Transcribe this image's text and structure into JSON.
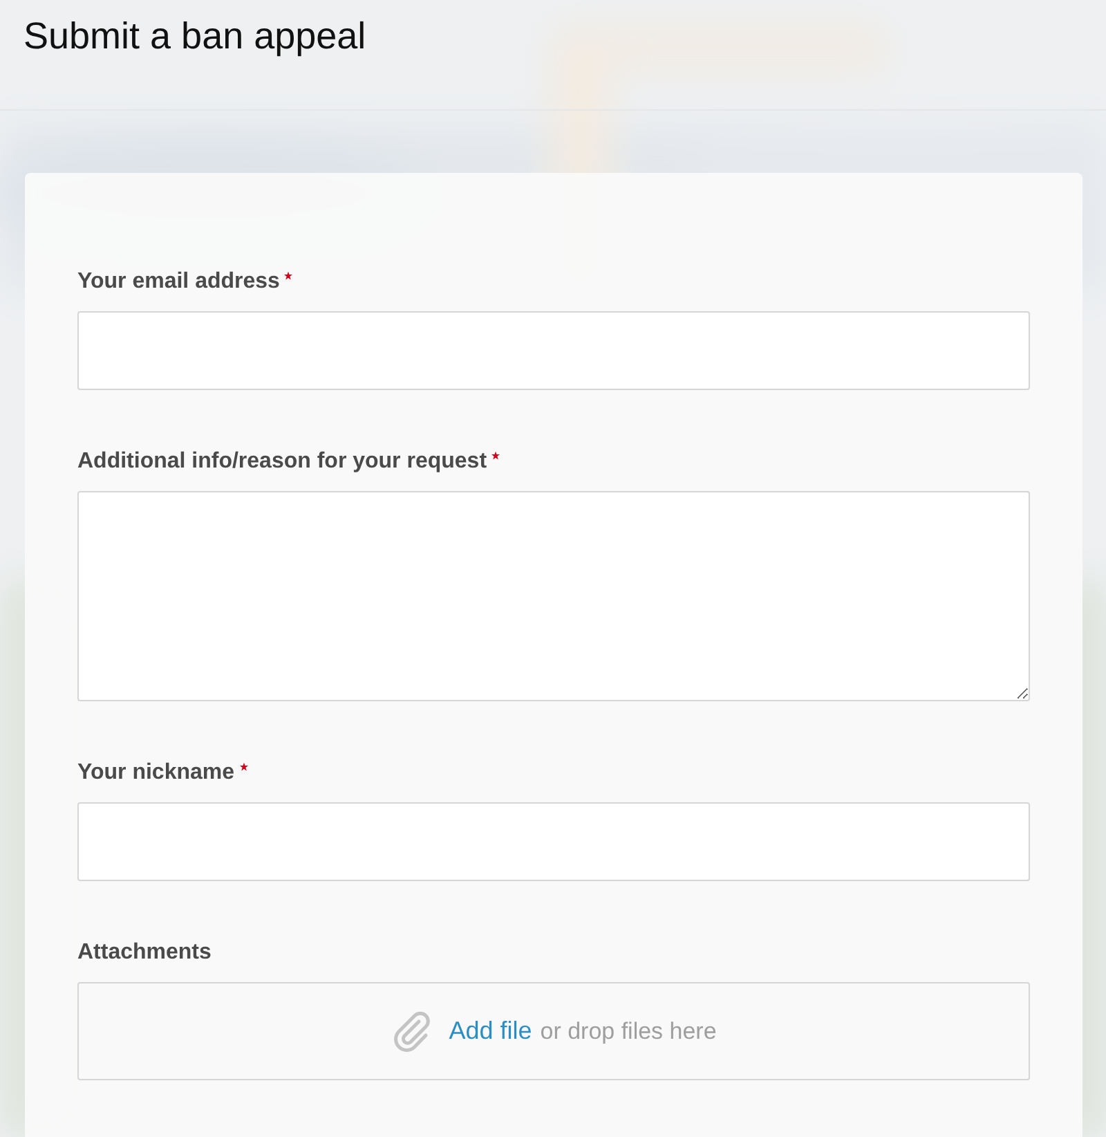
{
  "page": {
    "title": "Submit a ban appeal"
  },
  "form": {
    "fields": [
      {
        "kind": "input",
        "label": "Your email address",
        "required": true
      },
      {
        "kind": "textarea",
        "label": "Additional info/reason for your request",
        "required": true
      },
      {
        "kind": "input",
        "label": "Your nickname",
        "required": true
      },
      {
        "kind": "dropzone",
        "label": "Attachments",
        "required": false,
        "link": "Add file",
        "hint": "or drop files here"
      }
    ]
  }
}
